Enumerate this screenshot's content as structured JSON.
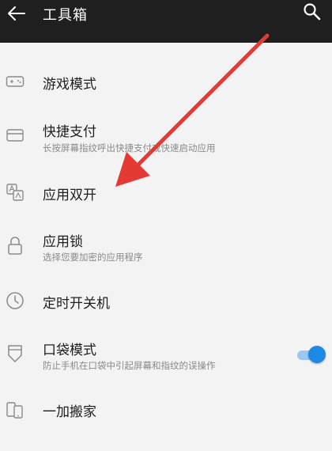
{
  "header": {
    "title": "工具箱"
  },
  "items": [
    {
      "label": "游戏模式",
      "icon": "gamepad-icon"
    },
    {
      "label": "快捷支付",
      "sub": "长按屏幕指纹呼出快捷支付或快速启动应用",
      "icon": "card-icon"
    },
    {
      "label": "应用双开",
      "icon": "app-clone-icon"
    },
    {
      "label": "应用锁",
      "sub": "选择您要加密的应用程序",
      "icon": "lock-icon"
    },
    {
      "label": "定时开关机",
      "icon": "clock-icon"
    },
    {
      "label": "口袋模式",
      "sub": "防止手机在口袋中引起屏幕和指纹的误操作",
      "icon": "pocket-icon",
      "toggle_on": true
    },
    {
      "label": "一加搬家",
      "icon": "phone-transfer-icon"
    }
  ],
  "colors": {
    "topbar": "#1f1f1f",
    "background": "#f3f3f3",
    "toggle_accent": "#1e88e5",
    "annotation_arrow": "#e53935"
  }
}
